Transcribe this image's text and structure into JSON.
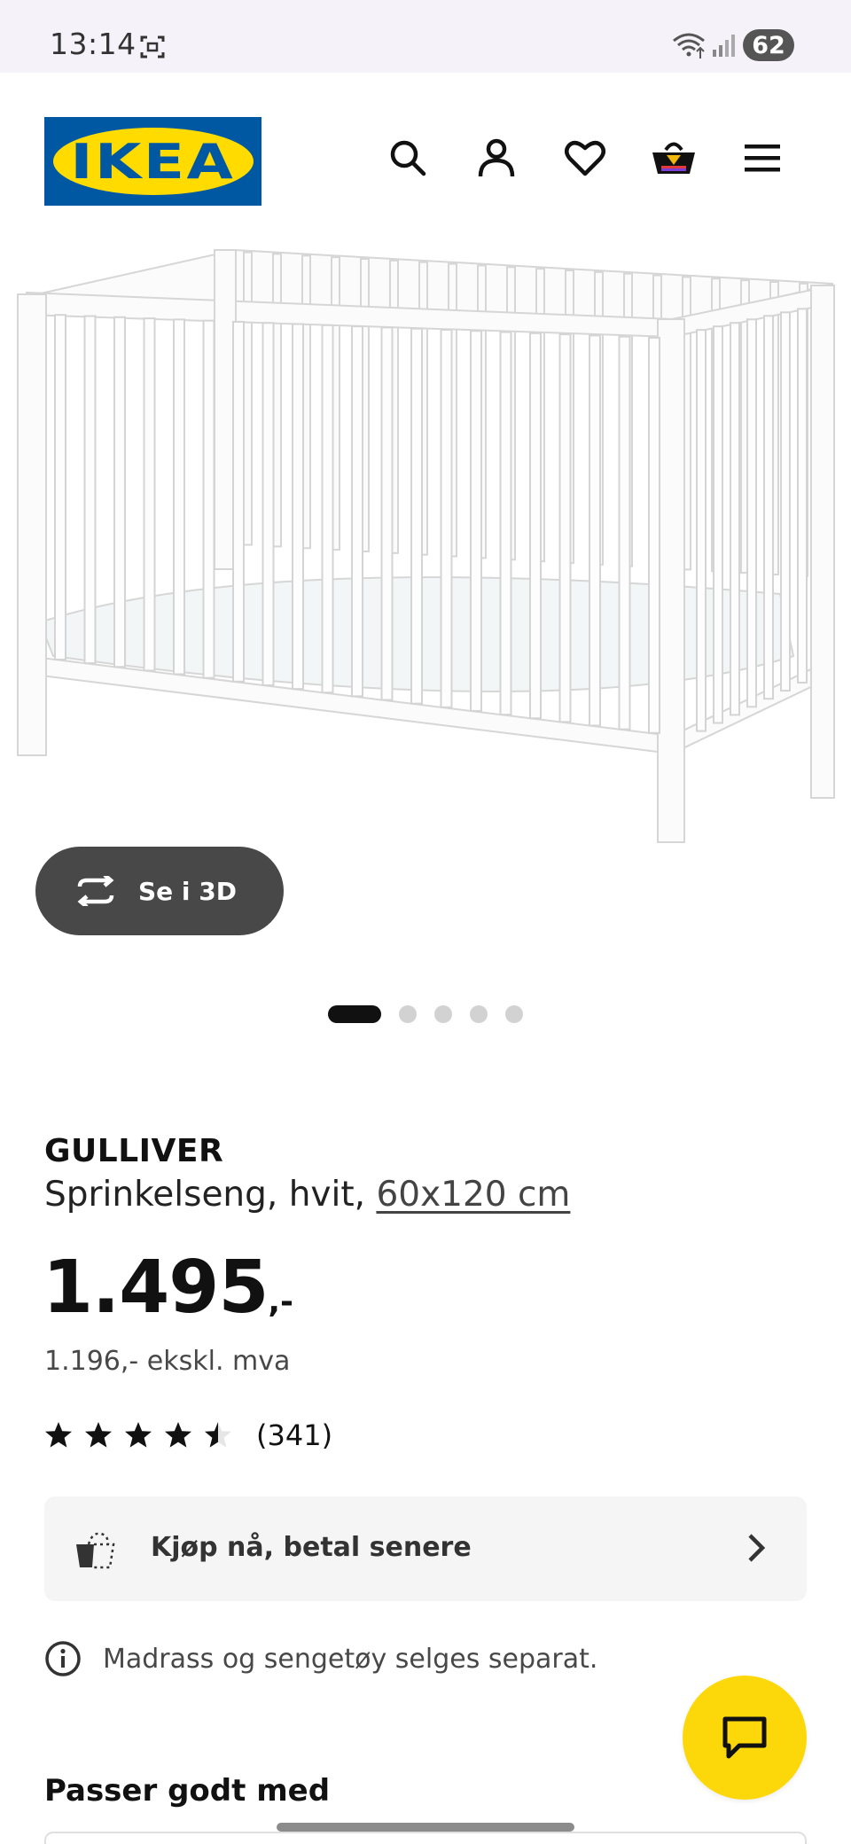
{
  "status_bar": {
    "time": "13:14",
    "battery": "62",
    "icons": [
      "screenshot-icon",
      "wifi-icon",
      "signal-icon"
    ]
  },
  "header": {
    "logo_text": "IKEA",
    "icons": [
      "search-icon",
      "account-icon",
      "heart-icon",
      "cart-icon",
      "menu-icon"
    ]
  },
  "gallery": {
    "view_3d_label": "Se i 3D",
    "dot_count": 5,
    "active_dot": 1
  },
  "product": {
    "name": "GULLIVER",
    "description": "Sprinkelseng, hvit, ",
    "size": "60x120 cm",
    "price_main": "1.495",
    "price_suffix": ",-",
    "price_ex_vat": "1.196,- ekskl. mva",
    "rating": 4.5,
    "review_count": "(341)"
  },
  "bnpl": {
    "label": "Kjøp nå, betal senere"
  },
  "notice": {
    "text": "Madrass og sengetøy selges separat."
  },
  "section": {
    "title": "Passer godt med"
  },
  "colors": {
    "ikea_blue": "#0058a3",
    "ikea_yellow": "#ffdb00",
    "chat_yellow": "#fcd80a",
    "button_dark": "#484848"
  }
}
